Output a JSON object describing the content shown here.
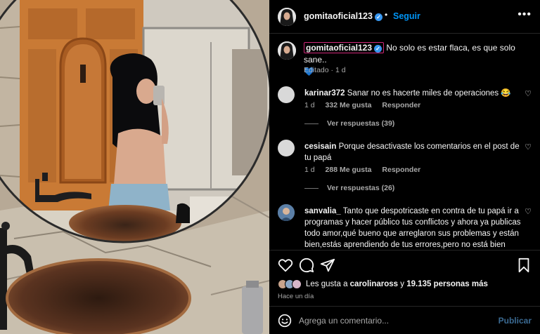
{
  "post": {
    "username": "gomitaoficial123",
    "dot": "•",
    "follow_label": "Seguir",
    "more_label": "•••"
  },
  "caption": {
    "author": "gomitaoficial123",
    "text": "No solo es estar flaca, es que solo sane..",
    "emoji": "💙",
    "edited": "Editado",
    "sep": "·",
    "time": "1 d"
  },
  "comments": [
    {
      "username": "karinar372",
      "text": "Sanar no es hacerte miles de operaciones 😂",
      "time": "1 d",
      "likes": "332 Me gusta",
      "reply_label": "Responder",
      "replies_label": "Ver respuestas (39)"
    },
    {
      "username": "cesisain",
      "text": "Porque desactivaste los comentarios en el post de tu papá",
      "time": "1 d",
      "likes": "288 Me gusta",
      "reply_label": "Responder",
      "replies_label": "Ver respuestas (26)"
    },
    {
      "username": "sanvalia_",
      "text": "Tanto que despotricaste en contra de tu papá ir a programas y hacer público tus conflictos y ahora ya publicas todo amor,qué bueno que arreglaron sus problemas y están bien,estás aprendiendo de tus errores,pero no está bien exponer y ventilar tus problemas mejor todo en privado"
    }
  ],
  "likes": {
    "prefix": "Les gusta a ",
    "first_liker": "carolinaross",
    "middle": " y ",
    "others": "19.135 personas más"
  },
  "posted_time": "Hace un día",
  "add_comment": {
    "placeholder": "Agrega un comentario...",
    "post_label": "Publicar"
  },
  "icons": {
    "like": "heart-outline-icon",
    "comment": "comment-bubble-icon",
    "share": "paper-plane-icon",
    "save": "bookmark-icon",
    "emoji": "smiley-icon",
    "verified": "verified-badge-icon",
    "more": "more-dots-icon"
  },
  "colors": {
    "background": "#000000",
    "follow": "#0095f6",
    "secondary_text": "#a8a8a8",
    "verified": "#3897f0",
    "divider": "#262626"
  }
}
